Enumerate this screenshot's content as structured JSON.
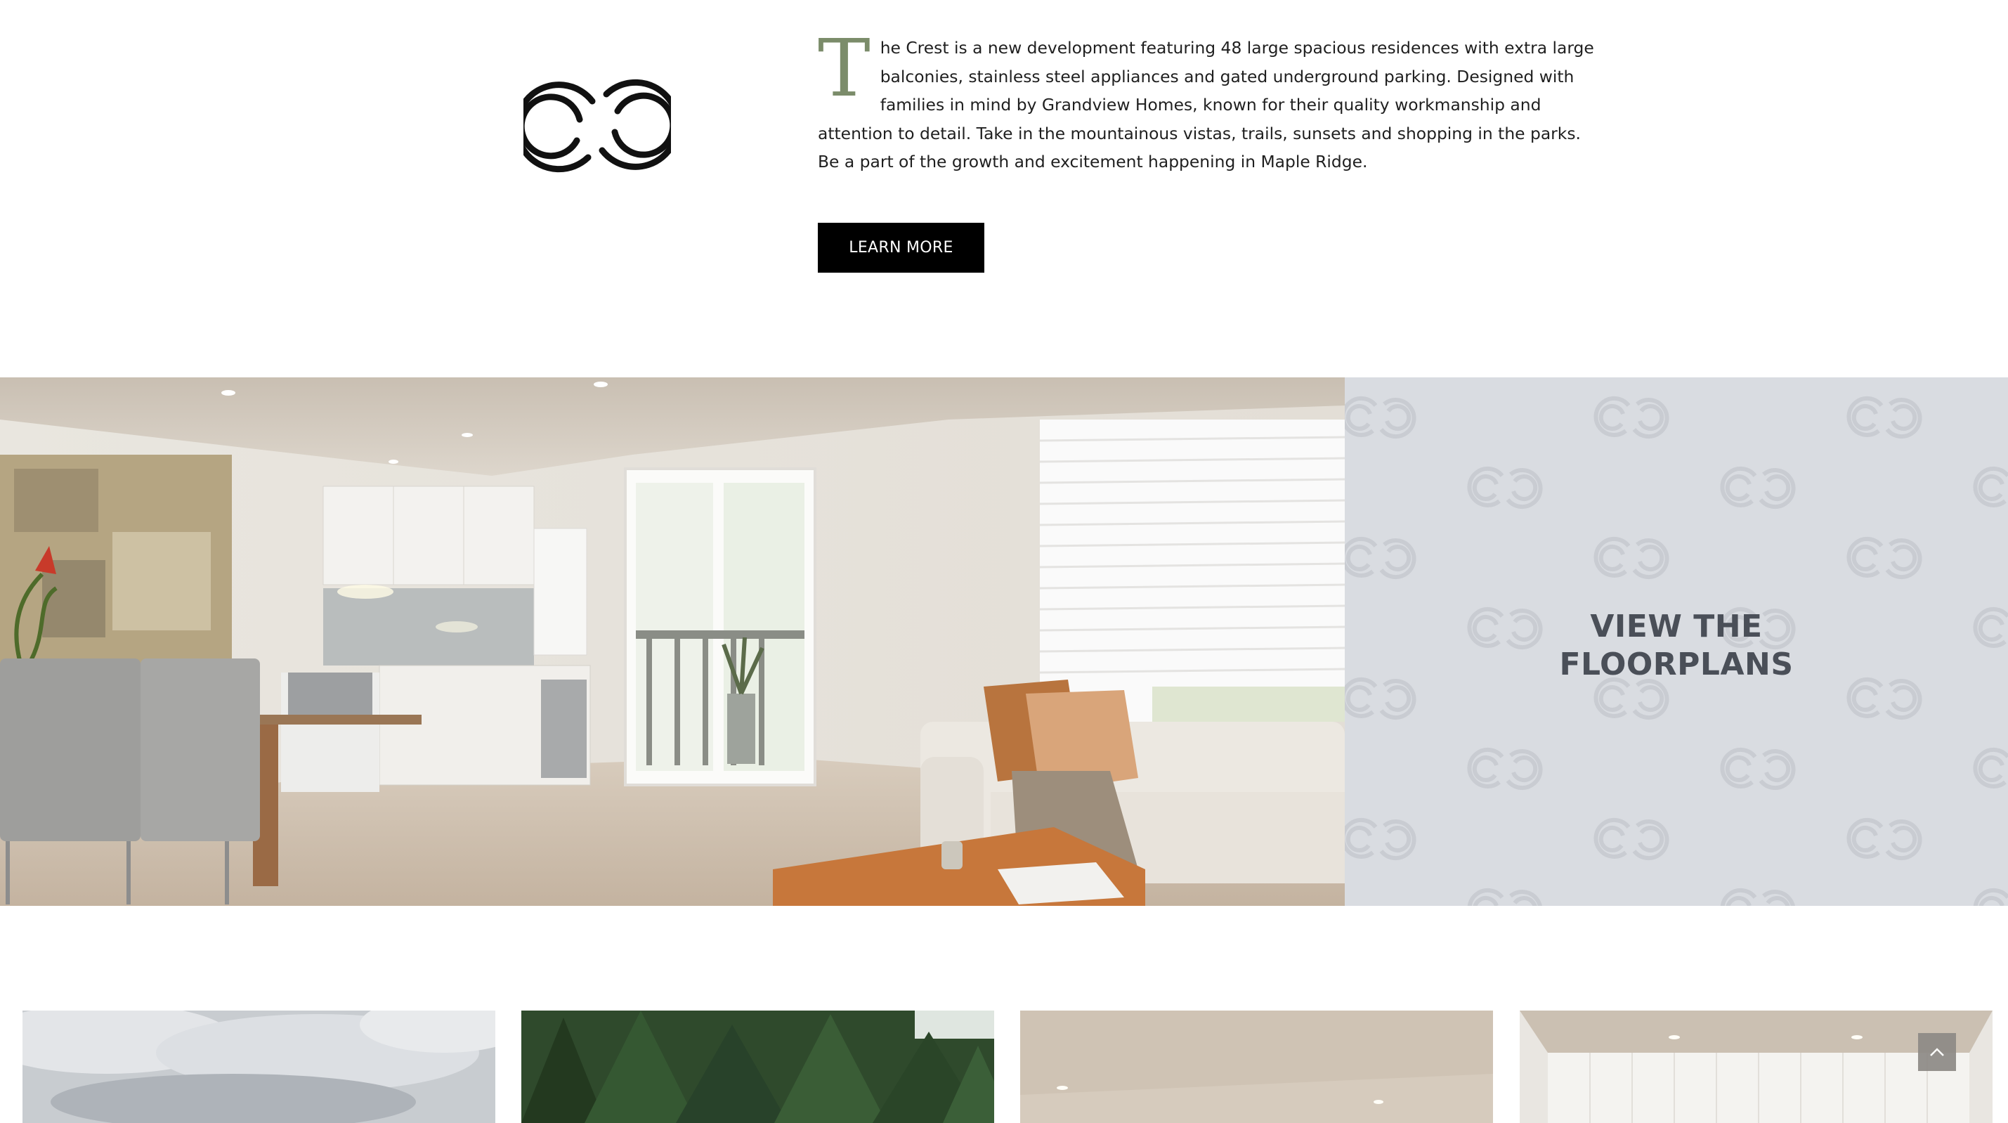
{
  "intro": {
    "drop_cap": "T",
    "paragraph": "he Crest is a new development featuring 48 large spacious residences with extra large balconies, stainless steel appliances and gated underground parking. Designed with families in mind by Grandview Homes, known for their quality workmanship and attention to detail. Take in the mountainous vistas, trails, sunsets and shopping in the parks. Be a part of the growth and excitement happening in Maple Ridge.",
    "learn_more_label": "LEARN MORE",
    "logo_icon": "crest-logo-icon"
  },
  "feature": {
    "image": "interior-living-kitchen-image",
    "floorplans_line1": "VIEW THE",
    "floorplans_line2": "FLOORPLANS"
  },
  "gallery": {
    "thumbnails": [
      "sky-clouds-image",
      "forest-trees-image",
      "interior-ceiling-image",
      "interior-room-image"
    ]
  },
  "scroll_top_icon": "chevron-up-icon",
  "colors": {
    "accent_green": "#7b8c6a",
    "button_black": "#000000",
    "floorplan_panel": "#d9dce1",
    "floorplan_text": "#4a4f58"
  }
}
